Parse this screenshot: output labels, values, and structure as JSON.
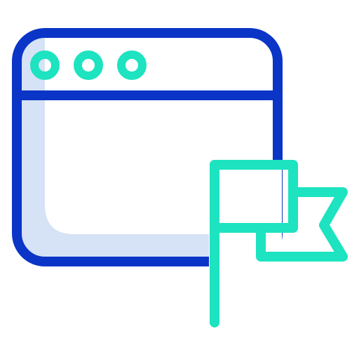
{
  "icon": {
    "name": "browser-window-with-flag-icon",
    "colors": {
      "window_outline": "#0a35c7",
      "window_shadow": "#d6e2f5",
      "accent": "#1de3c0",
      "background": "#ffffff"
    },
    "parts": {
      "window": "browser-window-icon",
      "dots": "window-control-dots",
      "flag": "flag-icon"
    }
  }
}
